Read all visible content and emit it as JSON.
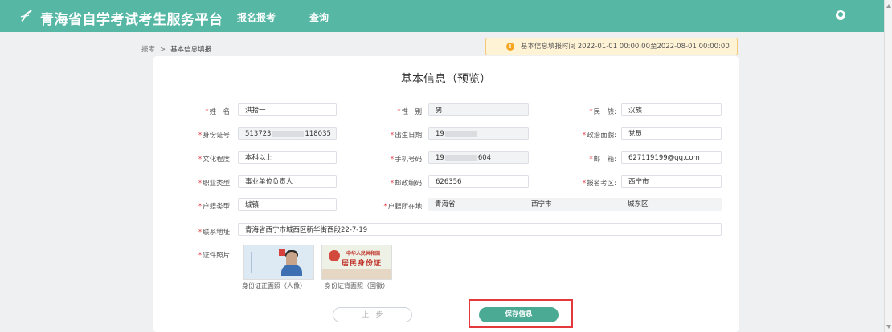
{
  "header": {
    "site_title": "青海省自学考试考生服务平台",
    "nav": [
      "报名报考",
      "查询"
    ]
  },
  "breadcrumb": {
    "parent": "报考",
    "separator": ">",
    "current": "基本信息填报"
  },
  "notice": {
    "text": "基本信息填报时间 2022-01-01 00:00:00至2022-08-01 00:00:00"
  },
  "form": {
    "title": "基本信息（预览）",
    "labels": {
      "name": "姓　名:",
      "gender": "性　别:",
      "ethnicity": "民　族:",
      "id_number": "身份证号:",
      "birth_date": "出生日期:",
      "political_status": "政治面貌:",
      "education": "文化程度:",
      "phone": "手机号码:",
      "email": "邮　箱:",
      "occupation": "职业类型:",
      "postcode": "邮政编码:",
      "exam_region": "报名考区:",
      "hukou_type": "户籍类型:",
      "hukou_location": "户籍所在地:",
      "address": "联系地址:",
      "photos": "证件照片:"
    },
    "values": {
      "name": "洪拾一",
      "gender": "男",
      "ethnicity": "汉族",
      "id_number_prefix": "513723",
      "id_number_suffix": "118035",
      "birth_date_prefix": "19",
      "political_status": "党员",
      "education": "本科以上",
      "phone_prefix": "19",
      "phone_suffix": "604",
      "email": "627119199@qq.com",
      "occupation": "事业单位负责人",
      "postcode": "626356",
      "exam_region": "西宁市",
      "hukou_type": "城镇",
      "province": "青海省",
      "city": "西宁市",
      "district": "城东区",
      "address": "青海省西宁市城西区新华街西段22-7-19"
    },
    "photo_captions": {
      "front": "身份证正面照（人像）",
      "back": "身份证背面照（国徽）"
    },
    "id_back_texts": {
      "line1": "中华人民共和国",
      "line2": "居民身份证"
    }
  },
  "buttons": {
    "prev": "上一步",
    "save": "保存信息"
  },
  "colors": {
    "brand": "#55b7a4",
    "save_button": "#4aaa94",
    "highlight": "#e4393c",
    "required": "#e4393c"
  }
}
